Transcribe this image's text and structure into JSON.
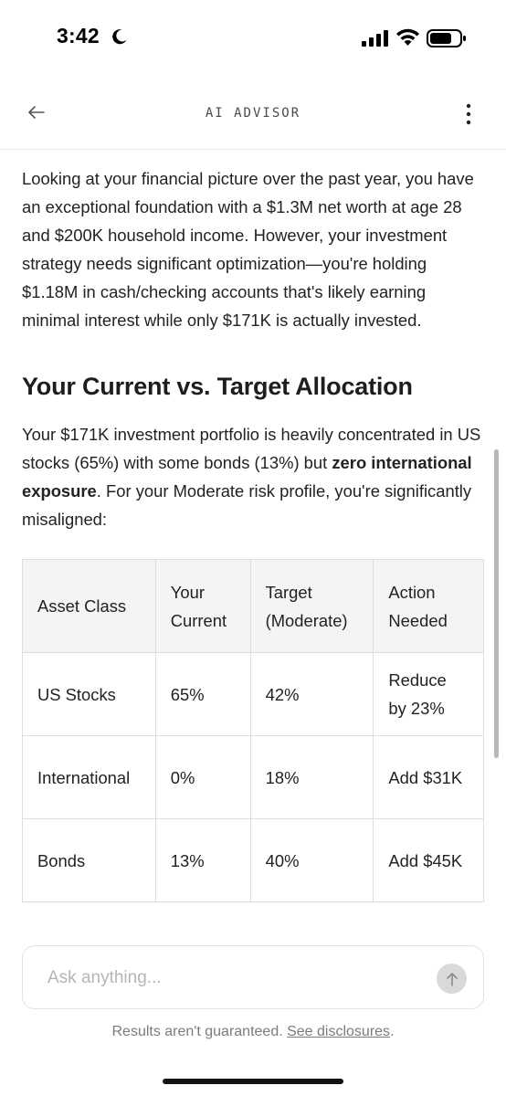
{
  "status_bar": {
    "time": "3:42",
    "icons": [
      "moon-icon",
      "signal-icon",
      "wifi-icon",
      "battery-icon"
    ]
  },
  "header": {
    "title": "AI ADVISOR",
    "back_icon": "arrow-left-icon",
    "menu_icon": "more-vertical-icon"
  },
  "content": {
    "intro": "Looking at your financial picture over the past year, you have an exceptional foundation with a $1.3M net worth at age 28 and $200K household income. However, your investment strategy needs significant optimization—you're holding $1.18M in cash/checking accounts that's likely earning minimal interest while only $171K is actually invested.",
    "heading": "Your Current vs. Target Allocation",
    "allocation_text_1": "Your $171K investment portfolio is heavily concentrated in US stocks (65%) with some bonds (13%) but ",
    "allocation_text_bold": "zero international exposure",
    "allocation_text_2": ". For your Moderate risk profile, you're significantly misaligned:",
    "table": {
      "headers": [
        "Asset Class",
        "Your Current",
        "Target (Moderate)",
        "Action Needed"
      ],
      "rows": [
        [
          "US Stocks",
          "65%",
          "42%",
          "Reduce by 23%"
        ],
        [
          "International",
          "0%",
          "18%",
          "Add $31K"
        ],
        [
          "Bonds",
          "13%",
          "40%",
          "Add $45K"
        ]
      ]
    }
  },
  "composer": {
    "placeholder": "Ask anything...",
    "value": "",
    "send_icon": "arrow-up-icon"
  },
  "footer": {
    "disclaimer": "Results aren't guaranteed.",
    "link_label": "See disclosures",
    "trailing": "."
  },
  "colors": {
    "text": "#222222",
    "header_bg": "#f4f4f4",
    "border": "#dedede",
    "muted": "#7c7c7c"
  }
}
